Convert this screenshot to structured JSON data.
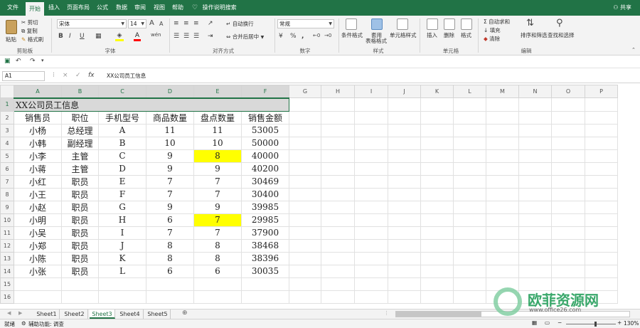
{
  "menu": {
    "tabs": [
      "文件",
      "开始",
      "插入",
      "页面布局",
      "公式",
      "数据",
      "审阅",
      "视图",
      "帮助"
    ],
    "active": "开始",
    "tell_me": "操作说明搜索",
    "share": "共享"
  },
  "ribbon": {
    "clipboard": {
      "paste": "粘贴",
      "cut": "剪切",
      "copy": "复制",
      "format_painter": "格式刷",
      "label": "剪贴板"
    },
    "font": {
      "name": "宋体",
      "size": "14",
      "bold": "B",
      "italic": "I",
      "underline": "U",
      "grow": "A",
      "shrink": "A",
      "font_color_letter": "A",
      "wen": "wén",
      "label": "字体"
    },
    "alignment": {
      "wrap": "自动换行",
      "merge": "合并后居中",
      "label": "对齐方式"
    },
    "number": {
      "format": "常规",
      "percent": "%",
      "comma": ",",
      "label": "数字"
    },
    "styles": {
      "cond": "条件格式",
      "table": "套用",
      "table2": "表格格式",
      "cell": "单元格样式",
      "label": "样式"
    },
    "cells": {
      "insert": "插入",
      "delete": "删除",
      "format": "格式",
      "label": "单元格"
    },
    "editing": {
      "autosum": "自动求和",
      "fill": "填充",
      "clear": "清除",
      "sort": "排序和筛选",
      "find": "查找和选择",
      "label": "编辑"
    }
  },
  "formula_bar": {
    "cell_ref": "A1",
    "fx": "fx",
    "cancel": "×",
    "enter": "✓",
    "content": "XX公司员工信息"
  },
  "sheet": {
    "columns": [
      "A",
      "B",
      "C",
      "D",
      "E",
      "F",
      "G",
      "H",
      "I",
      "J",
      "K",
      "L",
      "M",
      "N",
      "O",
      "P"
    ],
    "title": "XX公司员工信息",
    "headers": [
      "销售员",
      "职位",
      "手机型号",
      "商品数量",
      "盘点数量",
      "销售金额"
    ],
    "rows": [
      [
        "小杨",
        "总经理",
        "A",
        "11",
        "11",
        "53005"
      ],
      [
        "小韩",
        "副经理",
        "B",
        "10",
        "10",
        "50000"
      ],
      [
        "小李",
        "主管",
        "C",
        "9",
        "8",
        "40000"
      ],
      [
        "小蒋",
        "主管",
        "D",
        "9",
        "9",
        "40200"
      ],
      [
        "小红",
        "职员",
        "E",
        "7",
        "7",
        "30469"
      ],
      [
        "小王",
        "职员",
        "F",
        "7",
        "7",
        "30400"
      ],
      [
        "小赵",
        "职员",
        "G",
        "9",
        "9",
        "39985"
      ],
      [
        "小明",
        "职员",
        "H",
        "6",
        "7",
        "29985"
      ],
      [
        "小吴",
        "职员",
        "I",
        "7",
        "7",
        "37900"
      ],
      [
        "小郑",
        "职员",
        "J",
        "8",
        "8",
        "38468"
      ],
      [
        "小陈",
        "职员",
        "K",
        "8",
        "8",
        "38396"
      ],
      [
        "小张",
        "职员",
        "L",
        "6",
        "6",
        "30035"
      ]
    ],
    "row_numbers": [
      "1",
      "2",
      "3",
      "4",
      "5",
      "6",
      "7",
      "8",
      "9",
      "10",
      "11",
      "12",
      "13",
      "14",
      "15",
      "16"
    ],
    "highlight_color": "#ffff00"
  },
  "sheet_tabs": [
    "Sheet1",
    "Sheet2",
    "Sheet3",
    "Sheet4",
    "Sheet5"
  ],
  "active_sheet": "Sheet3",
  "status": {
    "ready": "就绪",
    "accessibility": "辅助功能: 调查",
    "zoom": "130%"
  },
  "watermark": {
    "brand": "欧菲资源网",
    "url": "www.office26.com"
  },
  "colors": {
    "accent": "#217346"
  }
}
